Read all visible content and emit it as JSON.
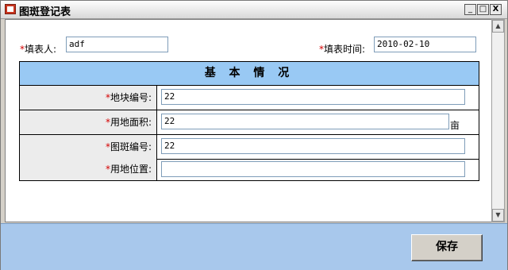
{
  "window": {
    "title": "图斑登记表",
    "min_label": "_",
    "max_label": "□",
    "close_label": "X"
  },
  "header": {
    "filler_label": "填表人:",
    "filler_value": "adf",
    "date_label": "填表时间:",
    "date_value": "2010-02-10",
    "required_mark": "*"
  },
  "section": {
    "title": "基 本 情 况"
  },
  "fields": [
    {
      "label": "地块编号:",
      "value": "22"
    },
    {
      "label": "用地面积:",
      "value": "22",
      "unit": "亩"
    },
    {
      "label": "图斑编号:",
      "value": "22"
    },
    {
      "label": "用地位置:",
      "value": ""
    }
  ],
  "footer": {
    "save_label": "保存"
  },
  "scroll": {
    "up": "▲",
    "down": "▼"
  }
}
